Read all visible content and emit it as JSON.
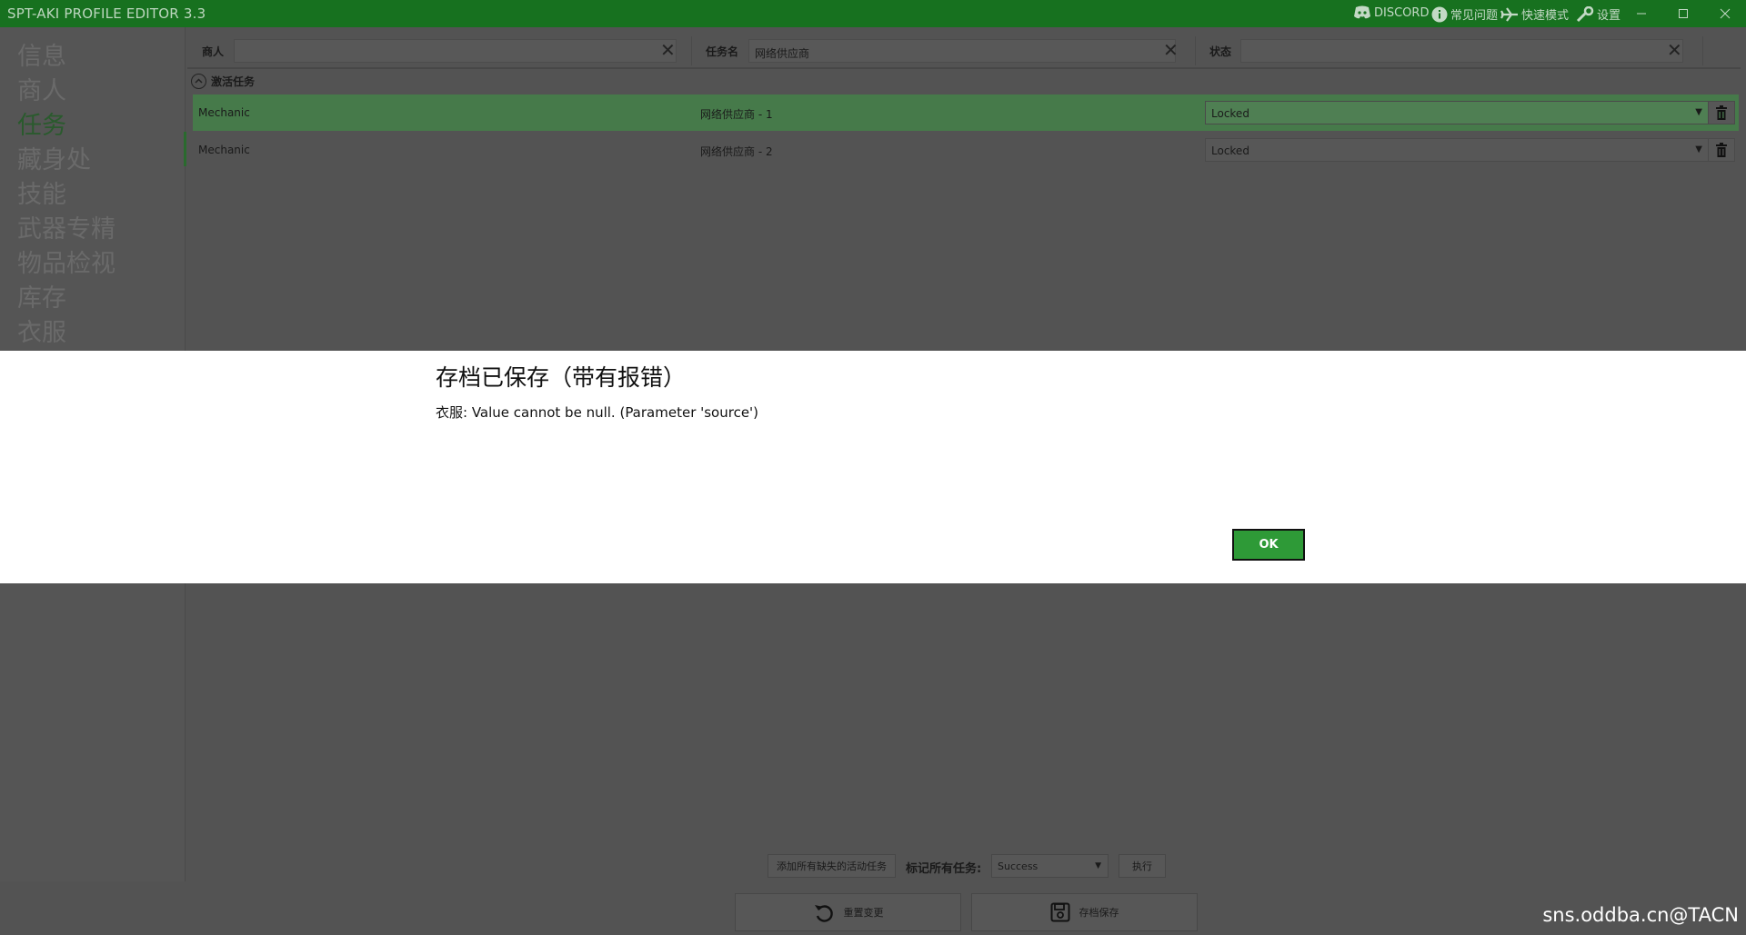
{
  "app": {
    "title": "SPT-AKI PROFILE EDITOR  3.3"
  },
  "titlebar": {
    "discord": "DISCORD",
    "faq": "常见问题",
    "fast_mode": "快速模式",
    "settings": "设置"
  },
  "sidebar": {
    "items": [
      {
        "label": "信息"
      },
      {
        "label": "商人"
      },
      {
        "label": "任务",
        "active": true
      },
      {
        "label": "藏身处"
      },
      {
        "label": "技能"
      },
      {
        "label": "武器专精"
      },
      {
        "label": "物品检视"
      },
      {
        "label": "库存"
      },
      {
        "label": "衣服"
      }
    ]
  },
  "filters": {
    "trader_label": "商人",
    "trader_value": "",
    "quest_label": "任务名",
    "quest_value": "网络供应商",
    "status_label": "状态",
    "status_value": ""
  },
  "quests": {
    "group_label": "激活任务",
    "rows": [
      {
        "trader": "Mechanic",
        "name": "网络供应商 - 1",
        "status": "Locked",
        "selected": true
      },
      {
        "trader": "Mechanic",
        "name": "网络供应商 - 2",
        "status": "Locked",
        "selected": false
      }
    ]
  },
  "bottom": {
    "add_missing": "添加所有缺失的活动任务",
    "mark_all_label": "标记所有任务:",
    "mark_all_value": "Success",
    "execute": "执行",
    "reset": "重置变更",
    "save": "存档保存"
  },
  "dialog": {
    "title": "存档已保存（带有报错）",
    "message": "衣服: Value cannot be null. (Parameter 'source')",
    "ok": "OK"
  },
  "watermark": "sns.oddba.cn@TACN",
  "colors": {
    "titlebar": "#17711f",
    "accent_green": "#2e9a37",
    "selected_row": "#467a4a",
    "background": "#535353"
  }
}
